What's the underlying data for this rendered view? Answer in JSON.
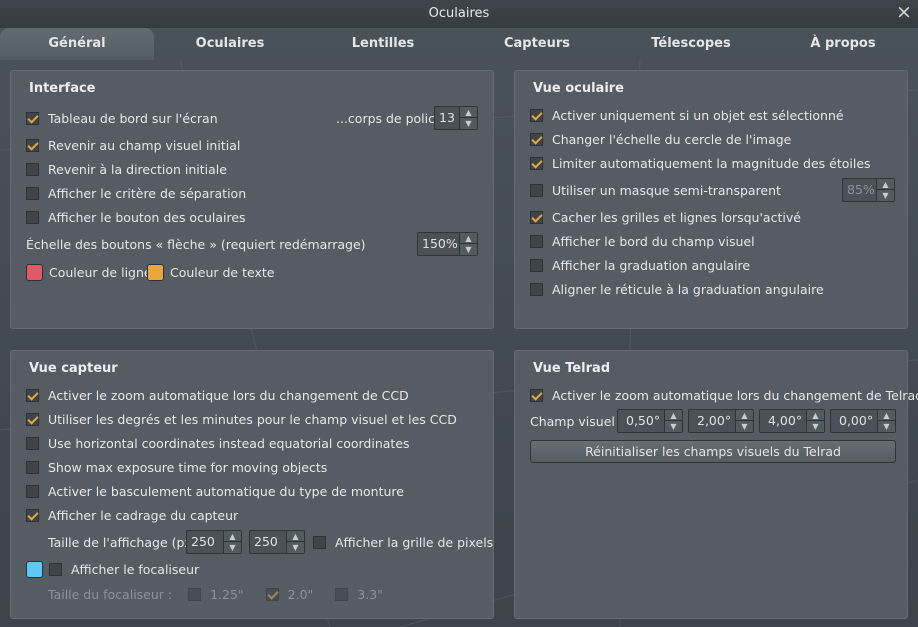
{
  "window": {
    "title": "Oculaires",
    "close_icon": "×"
  },
  "tabs": [
    {
      "label": "Général",
      "active": true
    },
    {
      "label": "Oculaires",
      "active": false
    },
    {
      "label": "Lentilles",
      "active": false
    },
    {
      "label": "Capteurs",
      "active": false
    },
    {
      "label": "Télescopes",
      "active": false
    },
    {
      "label": "À propos",
      "active": false
    }
  ],
  "interface": {
    "title": "Interface",
    "onscreen_panel": {
      "label": "Tableau de bord sur l'écran",
      "checked": true
    },
    "font_size_label": "...corps de police",
    "font_size_value": "13",
    "return_fov": {
      "label": "Revenir au champ visuel initial",
      "checked": true
    },
    "return_direction": {
      "label": "Revenir à la direction initiale",
      "checked": false
    },
    "show_separation": {
      "label": "Afficher le critère de séparation",
      "checked": false
    },
    "show_buttons": {
      "label": "Afficher le bouton des oculaires",
      "checked": false
    },
    "arrow_scale_label": "Échelle des boutons « flèche » (requiert redémarrage)",
    "arrow_scale_value": "150%",
    "line_color_label": "Couleur de ligne",
    "line_color": "#e05a66",
    "text_color_label": "Couleur de texte",
    "text_color": "#e9a640"
  },
  "eyepiece_view": {
    "title": "Vue oculaire",
    "items": [
      {
        "label": "Activer uniquement si un objet est sélectionné",
        "checked": true
      },
      {
        "label": "Changer l'échelle du cercle de l'image",
        "checked": true
      },
      {
        "label": "Limiter automatiquement la magnitude des étoiles",
        "checked": true
      },
      {
        "label": "Utiliser un masque semi-transparent",
        "checked": false
      },
      {
        "label": "Cacher les grilles et lignes lorsqu'activé",
        "checked": true
      },
      {
        "label": "Afficher le bord du champ visuel",
        "checked": false
      },
      {
        "label": "Afficher la graduation angulaire",
        "checked": false
      },
      {
        "label": "Aligner le réticule à la graduation angulaire",
        "checked": false
      }
    ],
    "mask_value": "85%"
  },
  "sensor_view": {
    "title": "Vue capteur",
    "items": [
      {
        "label": "Activer le zoom automatique lors du changement de CCD",
        "checked": true
      },
      {
        "label": "Utiliser les degrés et les minutes pour le champ visuel et les CCD",
        "checked": true
      },
      {
        "label": "Use horizontal coordinates instead equatorial coordinates",
        "checked": false
      },
      {
        "label": "Show max exposure time for moving objects",
        "checked": false
      },
      {
        "label": "Activer le basculement automatique du type de monture",
        "checked": false
      },
      {
        "label": "Afficher le cadrage du capteur",
        "checked": true
      }
    ],
    "display_size_label": "Taille de l'affichage (px)",
    "display_width": "250",
    "display_height": "250",
    "pixel_grid": {
      "label": "Afficher la grille de pixels",
      "checked": false
    },
    "focuser_color": "#5bc8f5",
    "show_focuser": {
      "label": "Afficher le focaliseur",
      "checked": false
    },
    "focuser_size_label": "Taille du focaliseur :",
    "focuser_sizes": [
      {
        "label": "1.25\"",
        "checked": false
      },
      {
        "label": "2.0\"",
        "checked": true
      },
      {
        "label": "3.3\"",
        "checked": false
      }
    ]
  },
  "telrad_view": {
    "title": "Vue Telrad",
    "auto_zoom": {
      "label": "Activer le zoom automatique lors du changement de Telrad",
      "checked": true
    },
    "fov_label": "Champ visuel :",
    "fov_values": [
      "0,50°",
      "2,00°",
      "4,00°",
      "0,00°"
    ],
    "reset_button": "Réinitialiser les champs visuels du Telrad"
  }
}
